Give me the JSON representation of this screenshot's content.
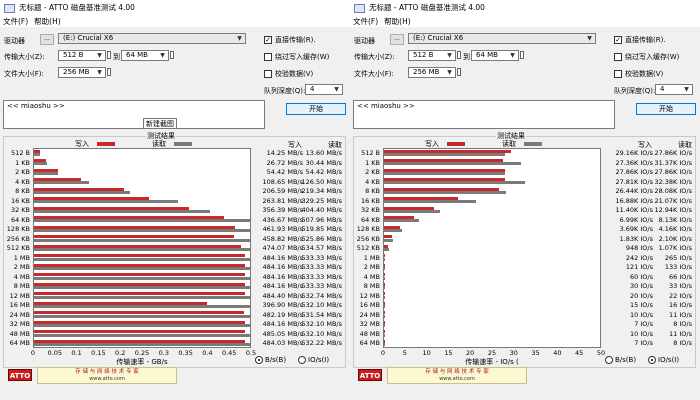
{
  "windows": [
    {
      "id": "left",
      "title": "无标题 - ATTO 磁盘基准测试 4.00",
      "menu": [
        "文件(F)",
        "帮助(H)"
      ],
      "drive_label": "驱动器",
      "drive_browse": "...",
      "drive_value": "(E:) Crucial X6",
      "transfer_size_label": "传输大小(Z):",
      "transfer_from": "512 B",
      "to_label": "到",
      "transfer_to": "64 MB",
      "file_size_label": "文件大小(F):",
      "file_size": "256 MB",
      "direct_io": {
        "label": "直接传输(R).",
        "checked": true
      },
      "bypass_write_cache": {
        "label": "绕过写入缓存(W)",
        "checked": false
      },
      "verify_data": {
        "label": "校验数据(V)",
        "checked": false
      },
      "queue_depth_label": "队列深度(Q):",
      "queue_depth": "4",
      "notes": "<< miaoshu >>",
      "start_button": "开始",
      "tooltip": "新建截图",
      "results_title": "测试结果",
      "legend_write": "写入",
      "legend_read": "读取",
      "col_write": "写入",
      "col_read": "读取",
      "axis_title": "传输速率 - GB/s",
      "radio_bytes": {
        "label": "B/s(B)",
        "selected": true
      },
      "radio_io": {
        "label": "IO/s(I)",
        "selected": false
      },
      "logo": "ATTO",
      "banner_line1": "存 储 与 网 络 技 术 专 家",
      "banner_line2": "www.atto.com",
      "chart_data": {
        "type": "bar",
        "title": "测试结果",
        "xlabel": "传输速率 - GB/s",
        "xlim": [
          0,
          0.5
        ],
        "ticks": [
          "0",
          "0.05",
          "0.1",
          "0.15",
          "0.2",
          "0.25",
          "0.3",
          "0.35",
          "0.4",
          "0.45",
          "0.5"
        ],
        "categories": [
          "512 B",
          "1 KB",
          "2 KB",
          "4 KB",
          "8 KB",
          "16 KB",
          "32 KB",
          "64 KB",
          "128 KB",
          "256 KB",
          "512 KB",
          "1 MB",
          "2 MB",
          "4 MB",
          "8 MB",
          "12 MB",
          "16 MB",
          "24 MB",
          "32 MB",
          "48 MB",
          "64 MB"
        ],
        "series": [
          {
            "name": "写入",
            "color": "#c62a2a",
            "values": [
              0.01425,
              0.02672,
              0.05442,
              0.10865,
              0.20659,
              0.26381,
              0.35639,
              0.43667,
              0.46193,
              0.45882,
              0.47407,
              0.48416,
              0.48416,
              0.48416,
              0.48416,
              0.4844,
              0.3969,
              0.48219,
              0.48416,
              0.48505,
              0.48403
            ]
          },
          {
            "name": "读取",
            "color": "#7a7a7a",
            "values": [
              0.0136,
              0.03044,
              0.05442,
              0.1265,
              0.21934,
              0.32925,
              0.4044,
              0.50796,
              0.51985,
              0.52586,
              0.53457,
              0.53333,
              0.53333,
              0.53333,
              0.53333,
              0.53274,
              0.5321,
              0.53154,
              0.5321,
              0.5321,
              0.53222
            ]
          }
        ],
        "write_labels": [
          "14.25 MB/s",
          "26.72 MB/s",
          "54.42 MB/s",
          "108.65 MB/s",
          "206.59 MB/s",
          "263.81 MB/s",
          "356.39 MB/s",
          "436.67 MB/s",
          "461.93 MB/s",
          "458.82 MB/s",
          "474.07 MB/s",
          "484.16 MB/s",
          "484.16 MB/s",
          "484.16 MB/s",
          "484.16 MB/s",
          "484.40 MB/s",
          "396.90 MB/s",
          "482.19 MB/s",
          "484.16 MB/s",
          "485.05 MB/s",
          "484.03 MB/s"
        ],
        "read_labels": [
          "13.60 MB/s",
          "30.44 MB/s",
          "54.42 MB/s",
          "126.50 MB/s",
          "219.34 MB/s",
          "329.25 MB/s",
          "404.40 MB/s",
          "507.96 MB/s",
          "519.85 MB/s",
          "525.86 MB/s",
          "534.57 MB/s",
          "533.33 MB/s",
          "533.33 MB/s",
          "533.33 MB/s",
          "533.33 MB/s",
          "532.74 MB/s",
          "532.10 MB/s",
          "531.54 MB/s",
          "532.10 MB/s",
          "532.10 MB/s",
          "532.22 MB/s"
        ]
      }
    },
    {
      "id": "right",
      "title": "无标题 - ATTO 磁盘基准测试 4.00",
      "menu": [
        "文件(F)",
        "帮助(H)"
      ],
      "drive_label": "驱动器",
      "drive_browse": "...",
      "drive_value": "(E:) Crucial X6",
      "transfer_size_label": "传输大小(Z):",
      "transfer_from": "512 B",
      "to_label": "到",
      "transfer_to": "64 MB",
      "file_size_label": "文件大小(F):",
      "file_size": "256 MB",
      "direct_io": {
        "label": "直接传输(R).",
        "checked": true
      },
      "bypass_write_cache": {
        "label": "绕过写入缓存(W)",
        "checked": false
      },
      "verify_data": {
        "label": "校验数据(V)",
        "checked": false
      },
      "queue_depth_label": "队列深度(Q):",
      "queue_depth": "4",
      "notes": "<< miaoshu >>",
      "start_button": "开始",
      "tooltip": "",
      "results_title": "测试结果",
      "legend_write": "写入",
      "legend_read": "读取",
      "col_write": "写入",
      "col_read": "读取",
      "axis_title": "传输速率 - IO/s (",
      "radio_bytes": {
        "label": "B/s(B)",
        "selected": false
      },
      "radio_io": {
        "label": "IO/s(I)",
        "selected": true
      },
      "logo": "ATTO",
      "banner_line1": "存 储 与 网 络 技 术 专 家",
      "banner_line2": "www.atto.com",
      "chart_data": {
        "type": "bar",
        "title": "测试结果",
        "xlabel": "传输速率 - IO/s (",
        "xlim": [
          0,
          50
        ],
        "ticks": [
          "0",
          "5",
          "10",
          "15",
          "20",
          "25",
          "30",
          "35",
          "40",
          "45",
          "50"
        ],
        "categories": [
          "512 B",
          "1 KB",
          "2 KB",
          "4 KB",
          "8 KB",
          "16 KB",
          "32 KB",
          "64 KB",
          "128 KB",
          "256 KB",
          "512 KB",
          "1 MB",
          "2 MB",
          "4 MB",
          "8 MB",
          "12 MB",
          "16 MB",
          "24 MB",
          "32 MB",
          "48 MB",
          "64 MB"
        ],
        "series": [
          {
            "name": "写入",
            "color": "#c62a2a",
            "values": [
              29.16,
              27.36,
              27.86,
              27.81,
              26.44,
              16.88,
              11.4,
              6.99,
              3.69,
              1.83,
              0.948,
              0.242,
              0.121,
              0.06,
              0.03,
              0.02,
              0.015,
              0.01,
              0.007,
              0.01,
              0.007
            ]
          },
          {
            "name": "读取",
            "color": "#7a7a7a",
            "values": [
              27.86,
              31.37,
              27.86,
              32.38,
              28.08,
              21.07,
              12.94,
              8.13,
              4.16,
              2.1,
              1.07,
              0.265,
              0.133,
              0.066,
              0.033,
              0.022,
              0.016,
              0.011,
              0.008,
              0.011,
              0.008
            ]
          }
        ],
        "write_labels": [
          "29.16K IO/s",
          "27.36K IO/s",
          "27.86K IO/s",
          "27.81K IO/s",
          "26.44K IO/s",
          "16.88K IO/s",
          "11.40K IO/s",
          "6.99K IO/s",
          "3.69K IO/s",
          "1.83K IO/s",
          "948 IO/s",
          "242 IO/s",
          "121 IO/s",
          "60 IO/s",
          "30 IO/s",
          "20 IO/s",
          "15 IO/s",
          "10 IO/s",
          "7 IO/s",
          "10 IO/s",
          "7 IO/s"
        ],
        "read_labels": [
          "27.86K IO/s",
          "31.37K IO/s",
          "27.86K IO/s",
          "32.38K IO/s",
          "28.08K IO/s",
          "21.07K IO/s",
          "12.94K IO/s",
          "8.13K IO/s",
          "4.16K IO/s",
          "2.10K IO/s",
          "1.07K IO/s",
          "265 IO/s",
          "133 IO/s",
          "66 IO/s",
          "33 IO/s",
          "22 IO/s",
          "16 IO/s",
          "11 IO/s",
          "8 IO/s",
          "11 IO/s",
          "8 IO/s"
        ]
      }
    }
  ]
}
